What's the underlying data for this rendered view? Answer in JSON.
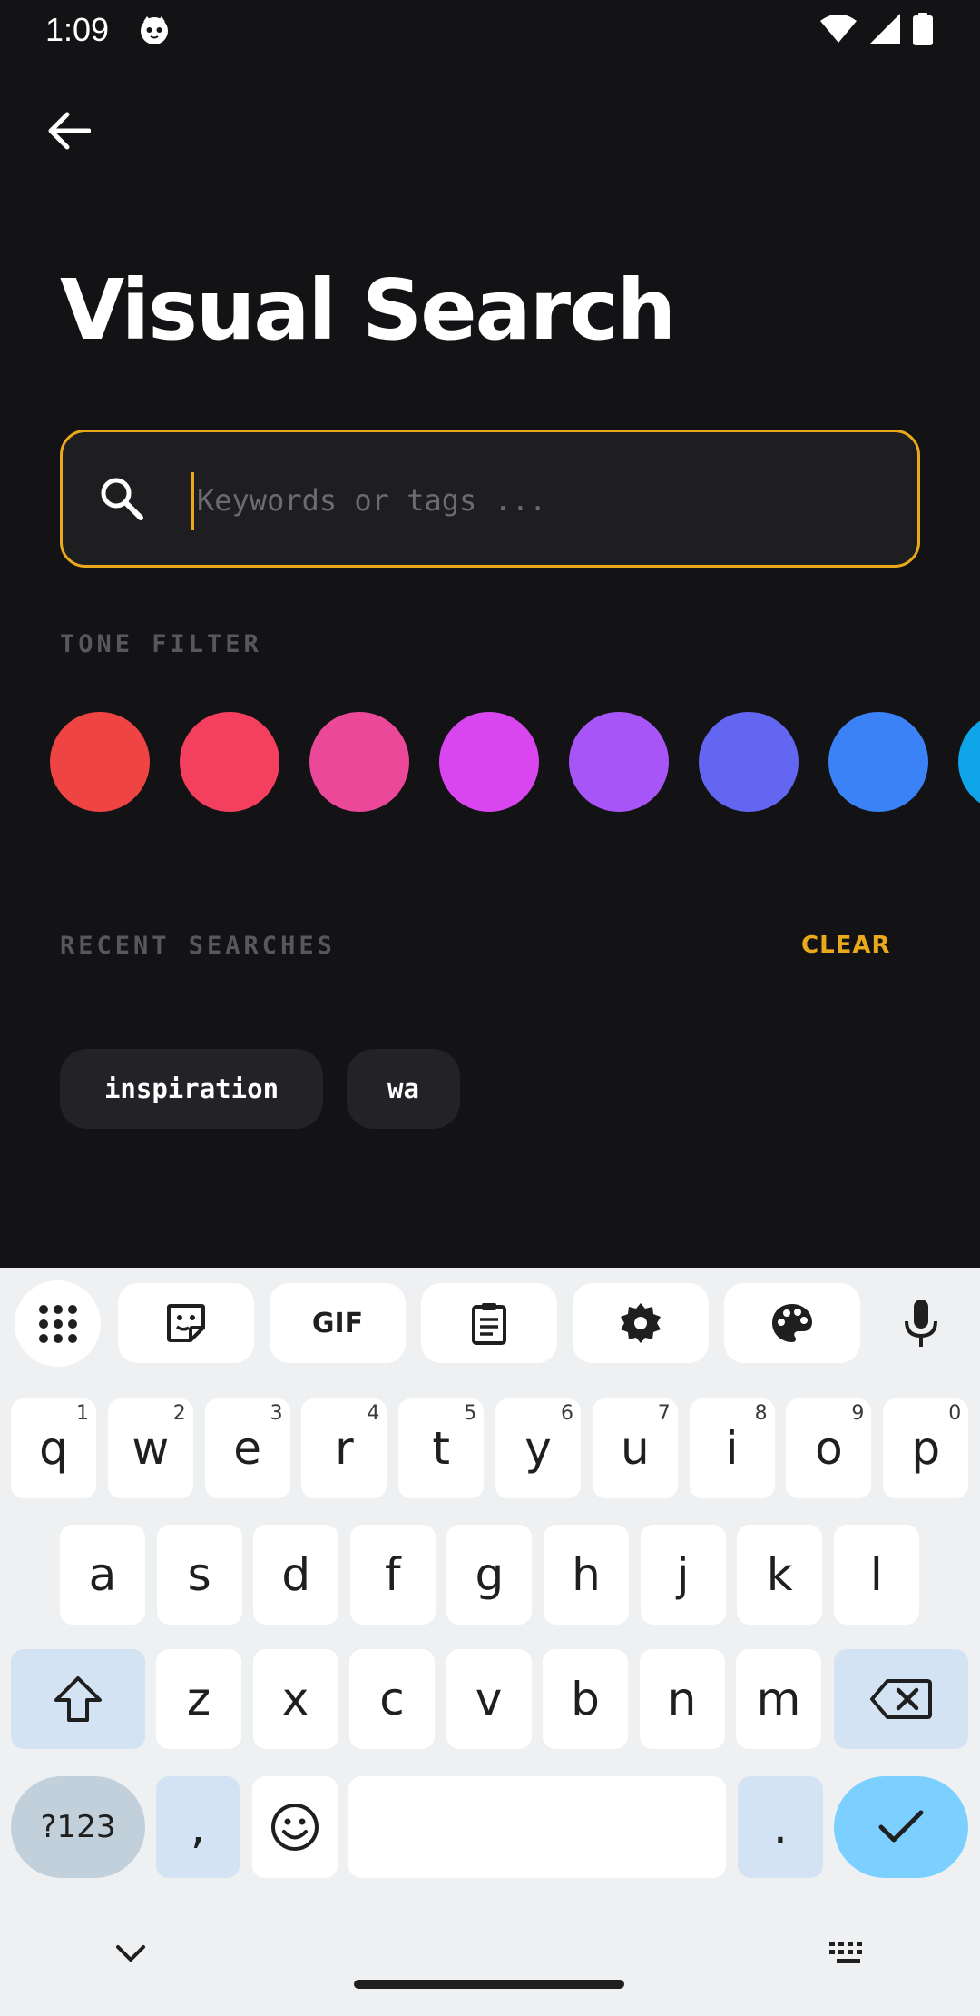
{
  "status_bar": {
    "time": "1:09"
  },
  "header": {
    "title": "Visual Search"
  },
  "search": {
    "placeholder": "Keywords or tags ..."
  },
  "tone_filter": {
    "label": "TONE FILTER",
    "colors": [
      "#ef4444",
      "#f43f5e",
      "#ec4899",
      "#d946ef",
      "#a855f7",
      "#6366f1",
      "#3b82f6",
      "#0ea5e9"
    ]
  },
  "recent_searches": {
    "label": "RECENT SEARCHES",
    "clear_label": "CLEAR",
    "items": [
      "inspiration",
      "wa"
    ]
  },
  "keyboard": {
    "toolbar": {
      "gif_label": "GIF"
    },
    "row1": [
      {
        "key": "q",
        "hint": "1"
      },
      {
        "key": "w",
        "hint": "2"
      },
      {
        "key": "e",
        "hint": "3"
      },
      {
        "key": "r",
        "hint": "4"
      },
      {
        "key": "t",
        "hint": "5"
      },
      {
        "key": "y",
        "hint": "6"
      },
      {
        "key": "u",
        "hint": "7"
      },
      {
        "key": "i",
        "hint": "8"
      },
      {
        "key": "o",
        "hint": "9"
      },
      {
        "key": "p",
        "hint": "0"
      }
    ],
    "row2": [
      "a",
      "s",
      "d",
      "f",
      "g",
      "h",
      "j",
      "k",
      "l"
    ],
    "row3": [
      "z",
      "x",
      "c",
      "v",
      "b",
      "n",
      "m"
    ],
    "row4": {
      "symbols": "?123",
      "comma": ",",
      "period": "."
    }
  }
}
